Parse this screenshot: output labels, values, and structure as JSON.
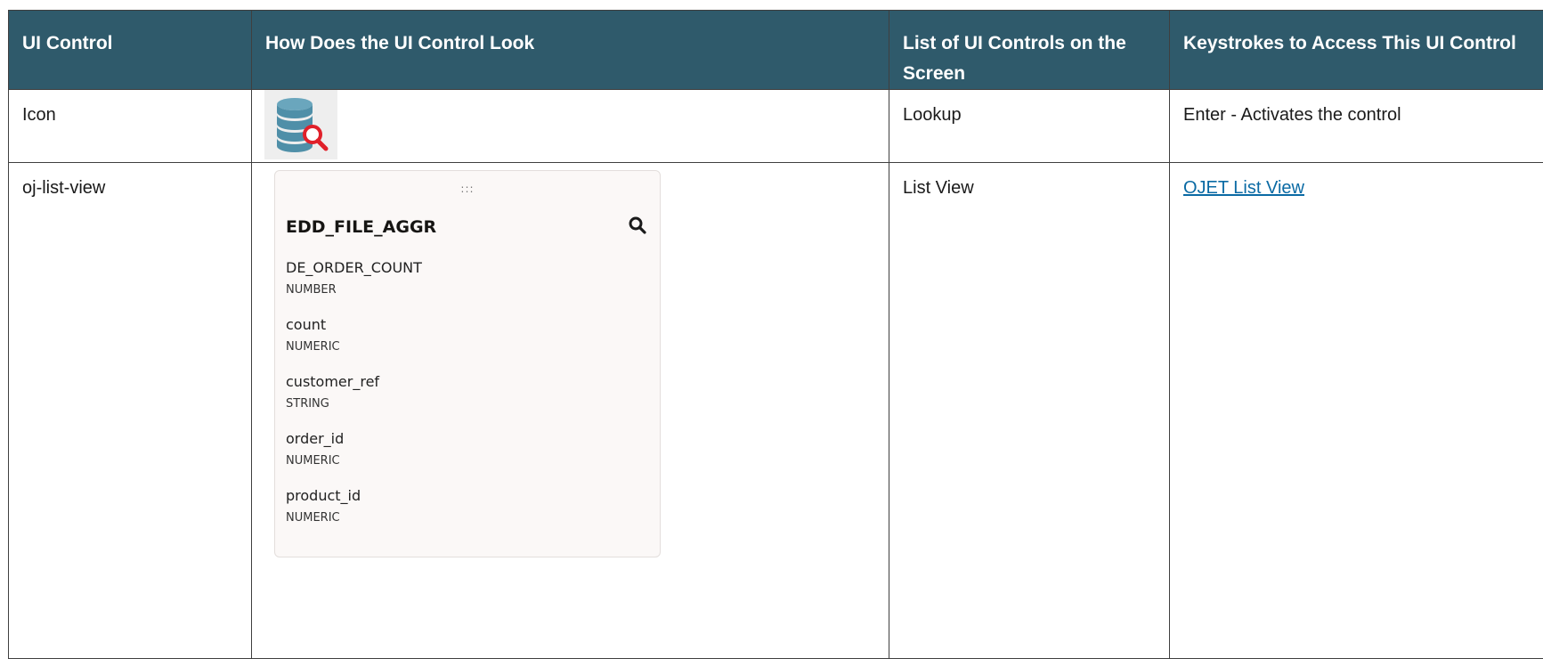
{
  "table": {
    "headers": [
      "UI Control",
      "How Does the UI Control Look",
      "List of UI Controls on the Screen",
      "Keystrokes to Access This UI Control"
    ],
    "rows": [
      {
        "control": "Icon",
        "icon": "database-search-icon",
        "list_name": "Lookup",
        "keystrokes": "Enter - Activates the control"
      },
      {
        "control": "oj-list-view",
        "list_name": "List View",
        "keystrokes_link": "OJET List View",
        "card": {
          "grip": ":::",
          "title": "EDD_FILE_AGGR",
          "search_icon": "search-icon",
          "items": [
            {
              "name": "DE_ORDER_COUNT",
              "type": "NUMBER"
            },
            {
              "name": "count",
              "type": "NUMERIC"
            },
            {
              "name": "customer_ref",
              "type": "STRING"
            },
            {
              "name": "order_id",
              "type": "NUMERIC"
            },
            {
              "name": "product_id",
              "type": "NUMERIC"
            }
          ]
        }
      }
    ]
  },
  "colors": {
    "header_bg": "#2f5a6b",
    "header_text": "#ffffff",
    "link": "#0a6aa4",
    "card_bg": "#fbf8f7",
    "db_icon": "#4f8fa8",
    "magnifier": "#e0202a"
  }
}
